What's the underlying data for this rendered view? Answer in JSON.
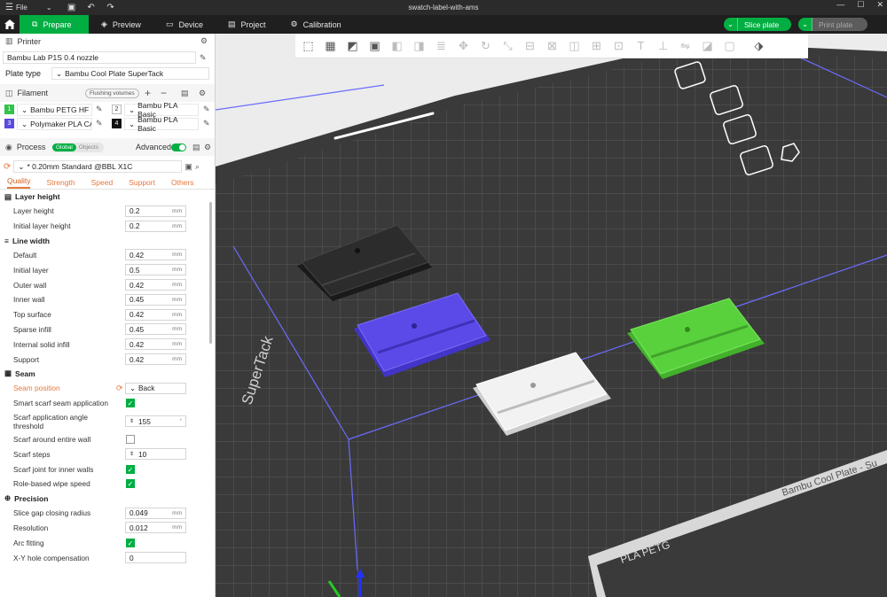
{
  "titlebar": {
    "file_label": "File",
    "title": "swatch-label-with-ams"
  },
  "nav": {
    "tabs": [
      "Prepare",
      "Preview",
      "Device",
      "Project",
      "Calibration"
    ],
    "slice_label": "Slice plate",
    "print_label": "Print plate"
  },
  "printer": {
    "section_label": "Printer",
    "name": "Bambu Lab P1S 0.4 nozzle",
    "plate_type_label": "Plate type",
    "plate_type": "Bambu Cool Plate SuperTack"
  },
  "filament": {
    "section_label": "Filament",
    "flushing_label": "Flushing volumes",
    "items": [
      {
        "num": "1",
        "name": "Bambu PETG HF",
        "color": "#33c24a"
      },
      {
        "num": "2",
        "name": "Bambu PLA Basic",
        "color": "#ffffff"
      },
      {
        "num": "3",
        "name": "Polymaker PLA CA...",
        "color": "#5b4ae0"
      },
      {
        "num": "4",
        "name": "Bambu PLA Basic",
        "color": "#111111"
      }
    ]
  },
  "process": {
    "section_label": "Process",
    "global_label": "Global",
    "objects_label": "Objects",
    "advanced_label": "Advanced",
    "preset": "* 0.20mm Standard @BBL X1C",
    "tabs": [
      "Quality",
      "Strength",
      "Speed",
      "Support",
      "Others"
    ]
  },
  "settings": {
    "layer_height": {
      "title": "Layer height",
      "rows": [
        {
          "label": "Layer height",
          "value": "0.2",
          "unit": "mm"
        },
        {
          "label": "Initial layer height",
          "value": "0.2",
          "unit": "mm"
        }
      ]
    },
    "line_width": {
      "title": "Line width",
      "rows": [
        {
          "label": "Default",
          "value": "0.42",
          "unit": "mm"
        },
        {
          "label": "Initial layer",
          "value": "0.5",
          "unit": "mm"
        },
        {
          "label": "Outer wall",
          "value": "0.42",
          "unit": "mm"
        },
        {
          "label": "Inner wall",
          "value": "0.45",
          "unit": "mm"
        },
        {
          "label": "Top surface",
          "value": "0.42",
          "unit": "mm"
        },
        {
          "label": "Sparse infill",
          "value": "0.45",
          "unit": "mm"
        },
        {
          "label": "Internal solid infill",
          "value": "0.42",
          "unit": "mm"
        },
        {
          "label": "Support",
          "value": "0.42",
          "unit": "mm"
        }
      ]
    },
    "seam": {
      "title": "Seam",
      "seam_position_label": "Seam position",
      "seam_position_value": "Back",
      "smart_scarf_label": "Smart scarf seam application",
      "scarf_angle_label": "Scarf application angle threshold",
      "scarf_angle_value": "155",
      "scarf_angle_unit": "°",
      "scarf_entire_label": "Scarf around entire wall",
      "scarf_steps_label": "Scarf steps",
      "scarf_steps_value": "10",
      "scarf_inner_label": "Scarf joint for inner walls",
      "role_wipe_label": "Role-based wipe speed"
    },
    "precision": {
      "title": "Precision",
      "rows": [
        {
          "label": "Slice gap closing radius",
          "value": "0.049",
          "unit": "mm"
        },
        {
          "label": "Resolution",
          "value": "0.012",
          "unit": "mm"
        }
      ],
      "arc_label": "Arc fitting",
      "xy_label": "X-Y hole compensation",
      "xy_value": "0"
    }
  },
  "plate": {
    "brand_text": "Bambu Cool Plate - Su",
    "material_text": "PLA PETG",
    "side_text": "SuperTack",
    "colors": {
      "black": "#262626",
      "purple": "#5b4ae8",
      "white": "#f2f2f2",
      "green": "#58d13c"
    }
  }
}
